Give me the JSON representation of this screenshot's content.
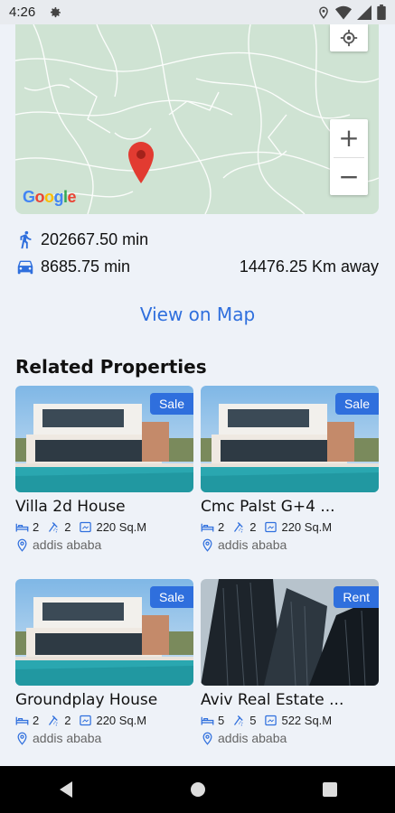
{
  "status_bar": {
    "time": "4:26"
  },
  "map": {
    "google_logo": "Google"
  },
  "distances": {
    "walk": "202667.50 min",
    "drive": "8685.75 min",
    "away": "14476.25 Km away"
  },
  "view_on_map": "View on Map",
  "related_title": "Related Properties",
  "colors": {
    "accent": "#2f6fdd"
  },
  "cards": [
    {
      "badge": "Sale",
      "title": "Villa 2d House",
      "beds": "2",
      "baths": "2",
      "area": "220 Sq.M",
      "location": "addis ababa",
      "image": "villa"
    },
    {
      "badge": "Sale",
      "title": "Cmc Palst G+4 ...",
      "beds": "2",
      "baths": "2",
      "area": "220 Sq.M",
      "location": "addis ababa",
      "image": "villa"
    },
    {
      "badge": "Sale",
      "title": "Groundplay House",
      "beds": "2",
      "baths": "2",
      "area": "220 Sq.M",
      "location": "addis ababa",
      "image": "villa"
    },
    {
      "badge": "Rent",
      "title": "Aviv Real Estate ...",
      "beds": "5",
      "baths": "5",
      "area": "522 Sq.M",
      "location": "addis ababa",
      "image": "towers"
    }
  ]
}
